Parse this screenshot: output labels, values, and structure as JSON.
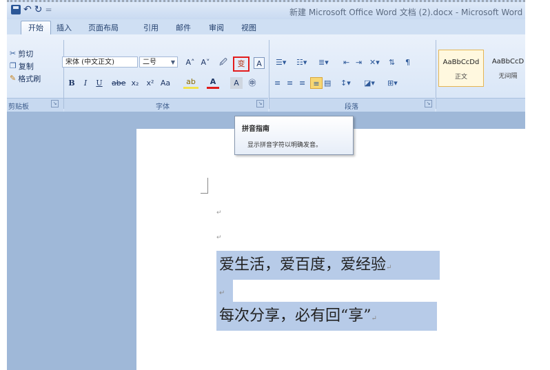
{
  "titlebar": {
    "window_title": "新建 Microsoft Office Word 文档 (2).docx - Microsoft Word",
    "quick_access": {
      "undo": "↶",
      "redo": "↻",
      "separator": "="
    }
  },
  "tabs": [
    {
      "label": "开始",
      "active": true
    },
    {
      "label": "插入"
    },
    {
      "label": "页面布局"
    },
    {
      "label": "引用"
    },
    {
      "label": "邮件"
    },
    {
      "label": "审阅"
    },
    {
      "label": "视图"
    }
  ],
  "clipboard": {
    "cut": "剪切",
    "copy": "复制",
    "format_painter": "格式刷",
    "group_label": "剪贴板"
  },
  "font": {
    "font_name": "宋体 (中文正文)",
    "font_size": "二号",
    "grow": "A˄",
    "shrink": "A˅",
    "clear": "🖉",
    "phonetic": "变",
    "border": "A",
    "bold": "B",
    "italic": "I",
    "underline": "U",
    "strike": "abe",
    "subscript": "x₂",
    "superscript": "x²",
    "change_case": "Aa",
    "highlight": "ab",
    "font_color": "A",
    "char_shading": "A",
    "enclose": "㊥",
    "group_label": "字体"
  },
  "paragraph": {
    "group_label": "段落"
  },
  "styles": [
    {
      "preview": "AaBbCcDd",
      "name": "正文",
      "selected": true
    },
    {
      "preview": "AaBbCcD",
      "name": "无间隔"
    }
  ],
  "tooltip": {
    "title": "拼音指南",
    "description": "显示拼音字符以明确发音。"
  },
  "document": {
    "line1": "爱生活，爱百度，爱经验",
    "line2": "每次分享，必有回“享”",
    "para_mark": "↵"
  },
  "colors": {
    "highlight_border": "#e31b1b",
    "selection": "#b7cbe8",
    "doc_background": "#9fb8d8",
    "ribbon_top": "#eaf1fb"
  }
}
